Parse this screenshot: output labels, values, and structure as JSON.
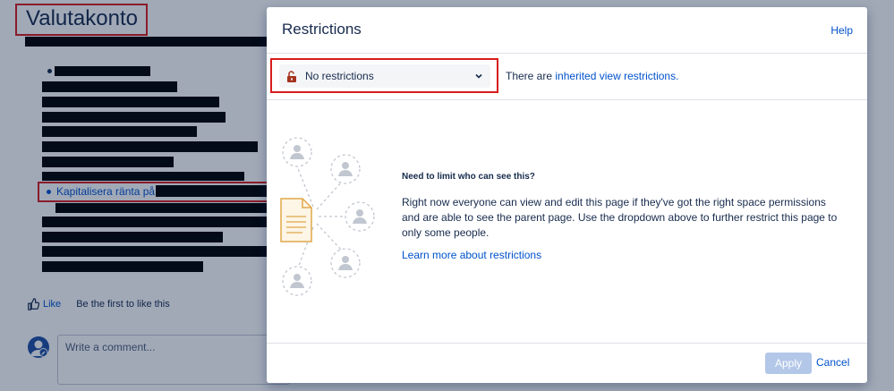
{
  "page": {
    "title": "Valutakonto",
    "link_item": "Kapitalisera ränta på",
    "like_label": "Like",
    "like_status": "Be the first to like this",
    "comment_placeholder": "Write a comment..."
  },
  "dialog": {
    "title": "Restrictions",
    "help_label": "Help",
    "select": {
      "value": "No restrictions"
    },
    "inherited": {
      "prefix": "There are",
      "link": "inherited view restrictions."
    },
    "info": {
      "heading": "Need to limit who can see this?",
      "body": "Right now everyone can view and edit this page if they've got the right space permissions and are able to see the parent page. Use the dropdown above to further restrict this page to only some people.",
      "link": "Learn more about restrictions"
    },
    "buttons": {
      "apply": "Apply",
      "cancel": "Cancel"
    }
  },
  "colors": {
    "accent": "#0052cc",
    "highlight": "#d81c1c",
    "text": "#172b4d",
    "illustration": "#e0a84a"
  }
}
